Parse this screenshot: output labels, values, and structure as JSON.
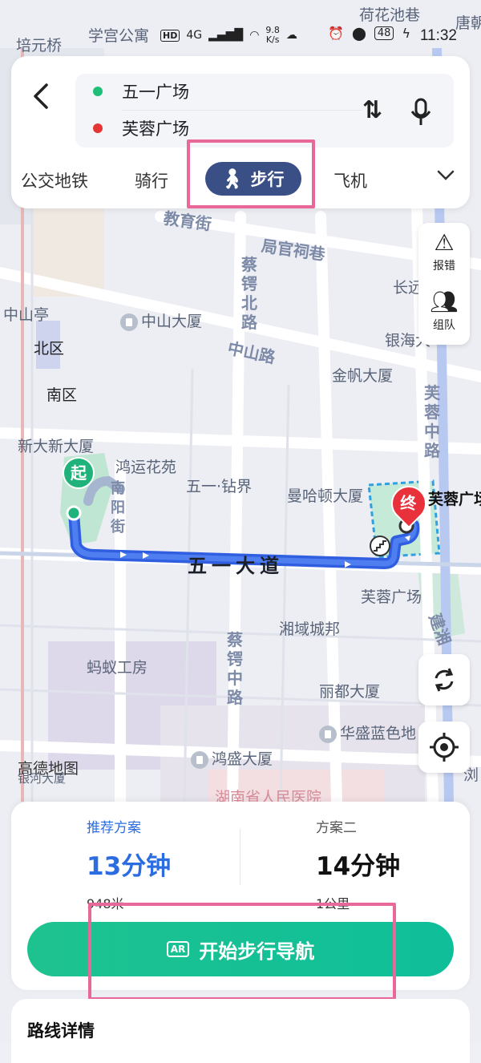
{
  "status_bar": {
    "network_type": "4G",
    "speed": "9.8",
    "speed_unit": "K/s",
    "battery": "48",
    "time": "11:32"
  },
  "route": {
    "origin": "五一广场",
    "destination": "芙蓉广场"
  },
  "modes": [
    "公交地铁",
    "骑行",
    "步行",
    "飞机"
  ],
  "active_mode": "步行",
  "side_buttons": {
    "report": "报错",
    "team": "组队"
  },
  "map_labels": {
    "peiyuanqiao": "培元桥",
    "xuegong": "学宫公寓",
    "hehuachi": "荷花池巷",
    "tangshi": "唐朝",
    "jiaoyujie": "教育街",
    "juguanci": "局官祠巷",
    "caie_north": "蔡锷北路",
    "zhongshanting": "中山亭",
    "zhongshandasha": "中山大厦",
    "zhongshanlu": "中山路",
    "beiqu": "北区",
    "nanqu": "南区",
    "xindaxin": "新大新大厦",
    "jinfan": "金帆大厦",
    "changyuan": "长远",
    "yinhai": "银海大",
    "furong_middle": "芙蓉中路",
    "hongyun": "鸿运花苑",
    "wuyi_zuanjie": "五一·钻界",
    "nanyangjie": "南阳街",
    "manhadun": "曼哈顿大厦",
    "start_marker": "起",
    "end_marker": "终",
    "end_name": "芙蓉广场",
    "wuyidadao": "五一大道",
    "furongguangchang": "芙蓉广场",
    "xiangyu": "湘域城邦",
    "caie_middle": "蔡锷中路",
    "mayi": "蚂蚁工房",
    "lidu": "丽都大厦",
    "huasheng": "华盛蓝色地",
    "gaode": "高德地图",
    "yinhe": "银河大厦",
    "hongsheng": "鸿盛大厦",
    "hospital": "湖南省人民医院",
    "liuyang": "浏",
    "jianxiang": "建湘"
  },
  "plans": [
    {
      "name": "推荐方案",
      "time": "13分钟",
      "distance": "948米"
    },
    {
      "name": "方案二",
      "time": "14分钟",
      "distance": "1公里"
    }
  ],
  "start_button": "开始步行导航",
  "ar_icon": "AR",
  "detail_title": "路线详情",
  "colors": {
    "route_blue": "#2f5fe0",
    "active_mode_bg": "#3a4f86",
    "start_button": "#16c295",
    "highlight": "#e9689a",
    "recommend": "#2b6de0"
  }
}
